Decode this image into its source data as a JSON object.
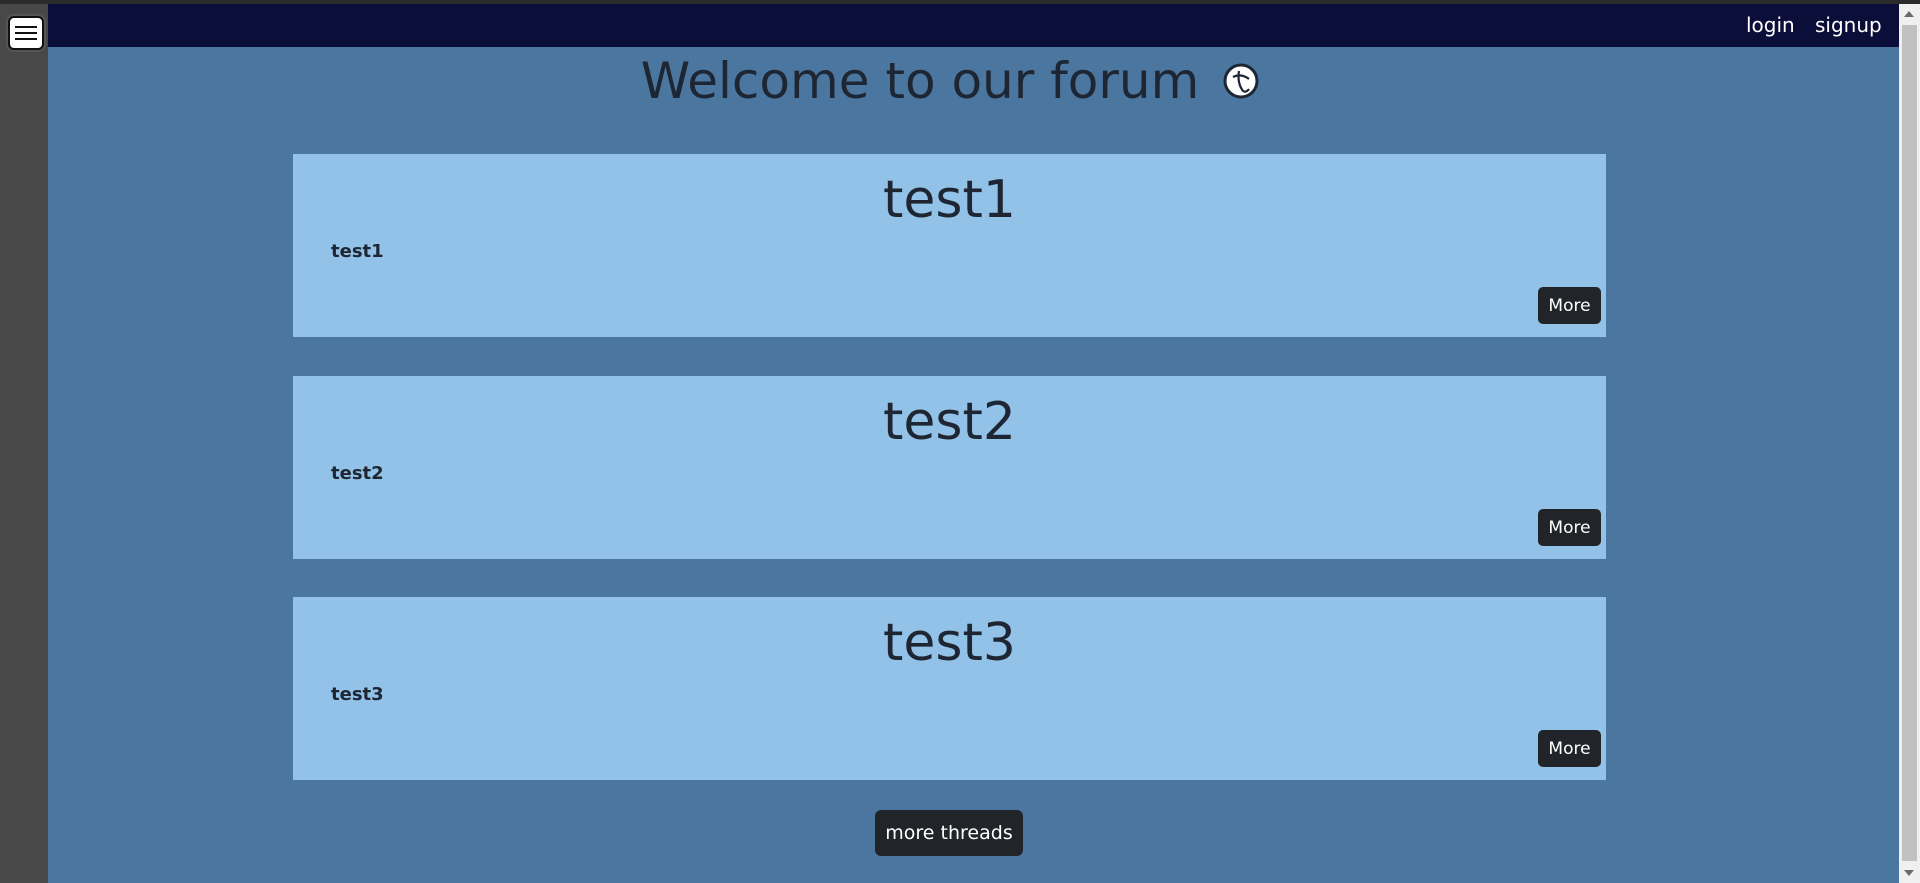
{
  "nav": {
    "menu_icon": "hamburger-icon",
    "login_label": "login",
    "signup_label": "signup"
  },
  "page": {
    "title": "Welcome to our forum",
    "logo_icon": "forum-logo-icon"
  },
  "threads": [
    {
      "title": "test1",
      "body": "test1",
      "more_label": "More"
    },
    {
      "title": "test2",
      "body": "test2",
      "more_label": "More"
    },
    {
      "title": "test3",
      "body": "test3",
      "more_label": "More"
    }
  ],
  "footer": {
    "more_threads_label": "more threads"
  },
  "colors": {
    "background": "#4a76a0",
    "navbar": "#0a0e38",
    "sidebar": "#484848",
    "card": "#92c2e7",
    "button": "#212529",
    "text": "#1e2633"
  }
}
